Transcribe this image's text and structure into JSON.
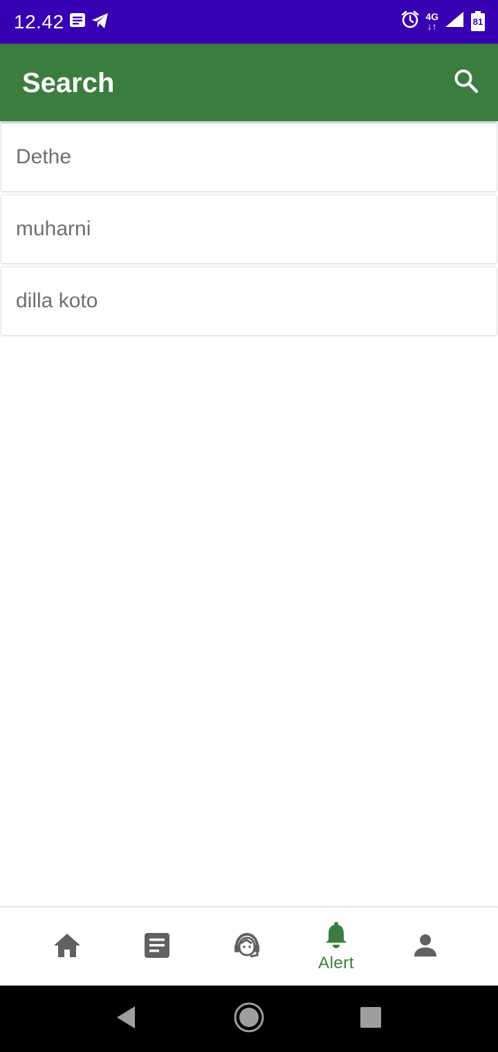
{
  "status_bar": {
    "time": "12.42",
    "network": "4G",
    "battery": "81",
    "icons": [
      "message-icon",
      "telegram-icon",
      "alarm-icon",
      "signal-icon",
      "battery-icon"
    ]
  },
  "app_bar": {
    "title": "Search",
    "search_icon": "search-icon"
  },
  "list": {
    "items": [
      {
        "label": "Dethe"
      },
      {
        "label": "muharni"
      },
      {
        "label": "dilla koto"
      }
    ]
  },
  "bottom_nav": {
    "active_color": "#3b7d3e",
    "inactive_color": "#616161",
    "items": [
      {
        "icon": "home-icon",
        "label": ""
      },
      {
        "icon": "article-icon",
        "label": ""
      },
      {
        "icon": "support-agent-icon",
        "label": ""
      },
      {
        "icon": "bell-icon",
        "label": "Alert",
        "active": true
      },
      {
        "icon": "person-icon",
        "label": ""
      }
    ]
  },
  "colors": {
    "status_bar": "#3700b3",
    "app_bar": "#3b7d3e",
    "list_text": "#6f6f6f"
  }
}
